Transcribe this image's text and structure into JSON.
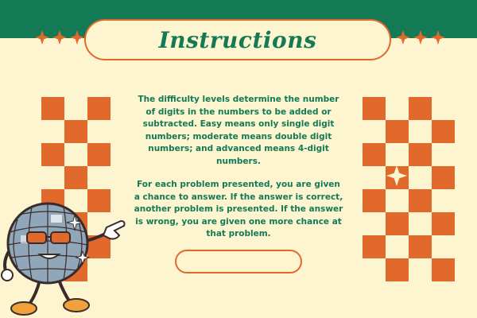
{
  "header": {
    "title": "Instructions"
  },
  "instructions": {
    "paragraph1": "The difficulty levels determine the number of digits in the numbers to be added or subtracted. Easy means only single digit numbers; moderate means double digit numbers; and advanced means 4-digit numbers.",
    "paragraph2": "For each problem presented, you are given a chance to answer. If the answer is correct, another problem is presented. If the answer is wrong, you are given one more chance at that problem."
  },
  "answer_field": {
    "value": ""
  },
  "colors": {
    "green": "#137a55",
    "orange": "#e2692c",
    "cream": "#fdf5cf"
  },
  "icons": {
    "decor": "sparkle-icon",
    "mascot": "disco-ball-mascot-icon"
  }
}
